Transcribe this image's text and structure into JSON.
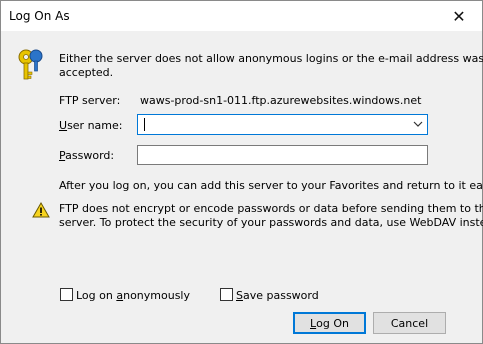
{
  "window": {
    "title": "Log On As",
    "close_glyph": "✕"
  },
  "message": {
    "line1": "Either the server does not allow anonymous logins or the e-mail address was not",
    "line2": "accepted."
  },
  "ftp_server": {
    "label": "FTP server:",
    "value": "waws-prod-sn1-011.ftp.azurewebsites.windows.net"
  },
  "user_name": {
    "label_prefix": "U",
    "label_rest": "ser name:",
    "value": ""
  },
  "password": {
    "label_prefix": "P",
    "label_rest": "assword:",
    "value": ""
  },
  "after_text": "After you log on, you can add this server to your Favorites and return to it easily.",
  "warning": {
    "line1": "FTP does not encrypt or encode passwords or data before sending them to the",
    "line2": "server.  To protect the security of your passwords and data, use WebDAV instead."
  },
  "options": {
    "anon_prefix": "Log on ",
    "anon_accel": "a",
    "anon_rest": "nonymously",
    "anon_checked": false,
    "save_accel": "S",
    "save_rest": "ave password",
    "save_checked": false
  },
  "buttons": {
    "logon_accel": "L",
    "logon_rest": "og On",
    "cancel": "Cancel"
  },
  "icons": {
    "key": "keys-icon",
    "warning": "warning-icon",
    "dropdown": "chevron-down-icon",
    "close": "close-icon"
  },
  "colors": {
    "accent": "#0078d7",
    "key_gold": "#d8b400",
    "warning_yellow": "#f7d41e"
  }
}
